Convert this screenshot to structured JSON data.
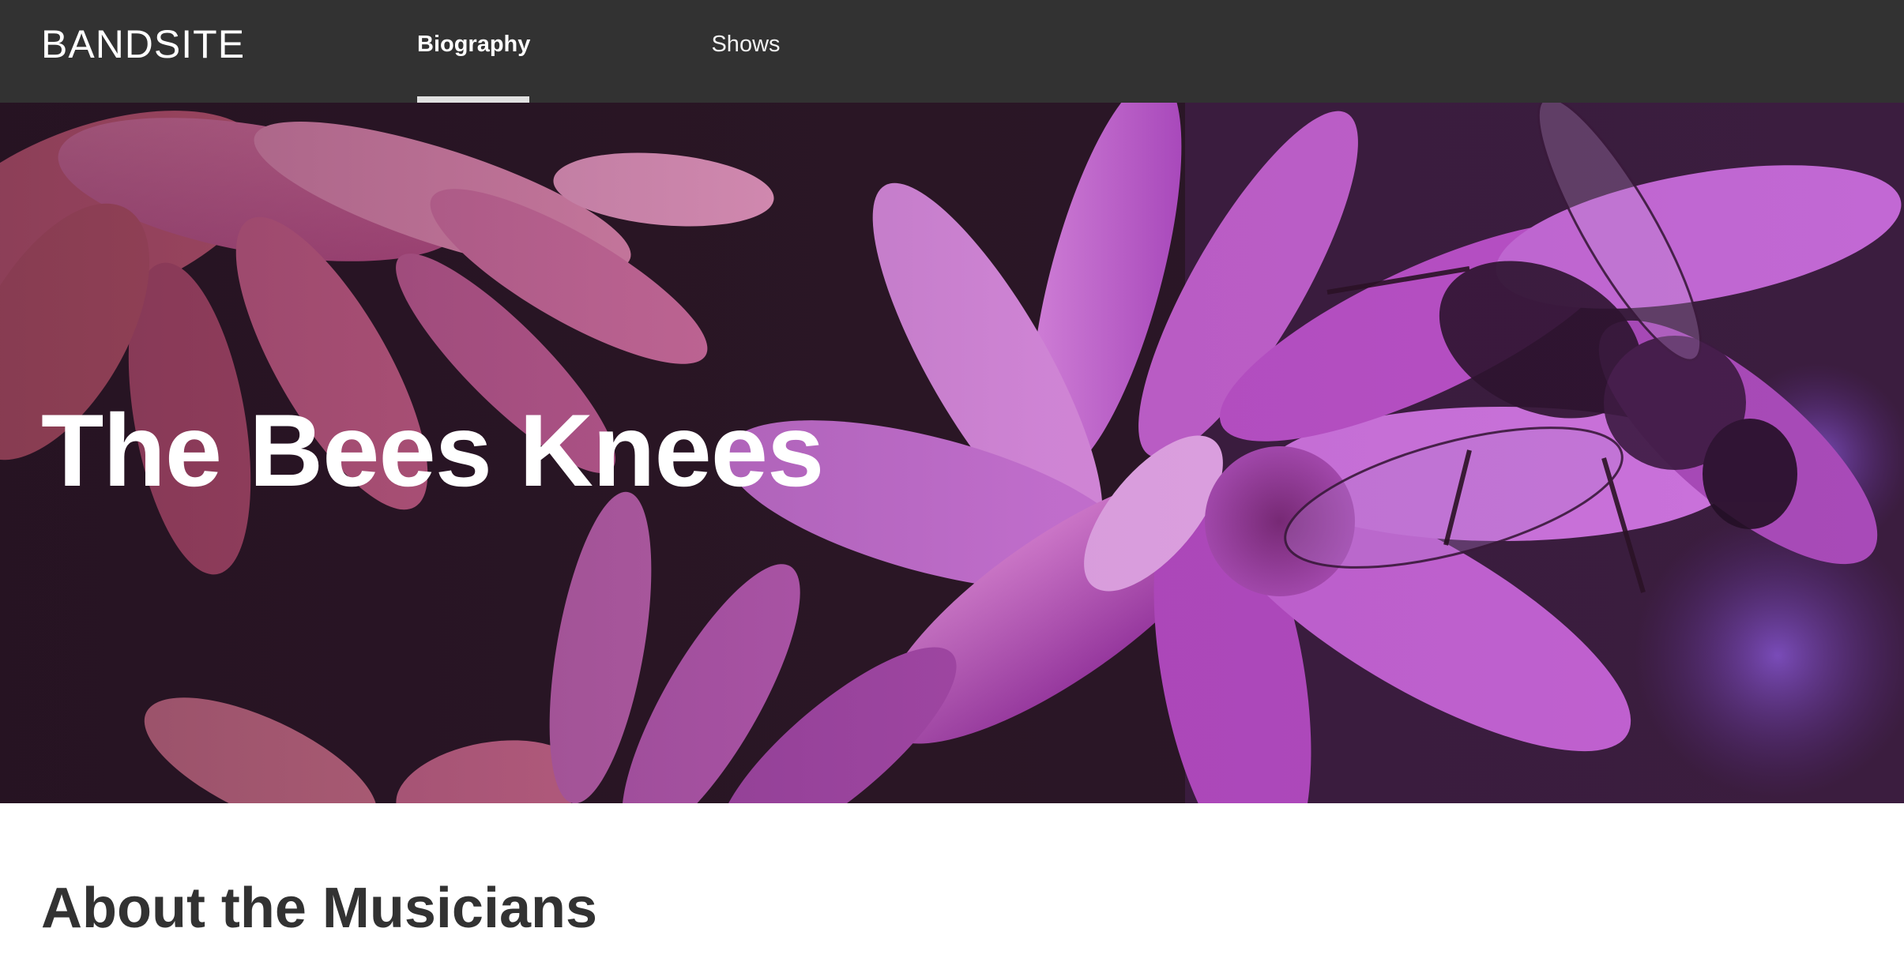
{
  "header": {
    "logo": "BANDSITE",
    "nav": [
      {
        "label": "Biography",
        "active": true
      },
      {
        "label": "Shows",
        "active": false
      }
    ]
  },
  "hero": {
    "title": "The Bees Knees",
    "image": "flowers-and-bee-hero-image"
  },
  "about": {
    "heading": "About the Musicians"
  },
  "colors": {
    "header_bg": "#323232",
    "nav_underline": "#e1e1e1",
    "text_dark": "#323232",
    "hero_pink": "#d25aa8",
    "hero_purple": "#b144c4"
  }
}
